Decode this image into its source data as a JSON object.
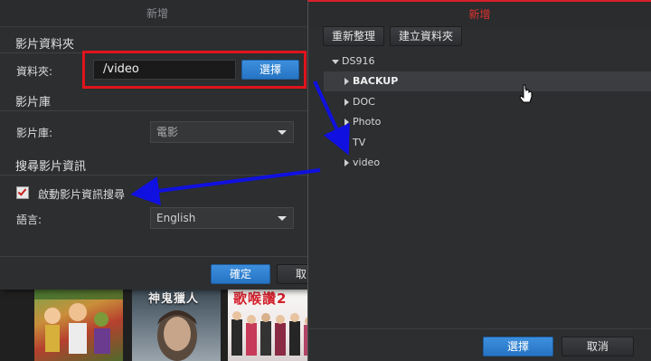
{
  "left_dialog": {
    "title": "新增",
    "section_folder": "影片資料夾",
    "folder_label": "資料夾:",
    "folder_value": "/video",
    "choose_button": "選擇",
    "section_library": "影片庫",
    "library_label": "影片庫:",
    "library_value": "電影",
    "section_search": "搜尋影片資訊",
    "enable_search_label": "啟動影片資訊搜尋",
    "language_label": "語言:",
    "language_value": "English",
    "ok_button": "確定",
    "cancel_button": "取"
  },
  "right_dialog": {
    "title": "新增",
    "refresh_button": "重新整理",
    "new_folder_button": "建立資料夾",
    "tree_root": "DS916",
    "tree_items": [
      "BACKUP",
      "DOC",
      "Photo",
      "TV",
      "video"
    ],
    "choose_button": "選擇",
    "cancel_button": "取消"
  },
  "posters": [
    {
      "title": ""
    },
    {
      "title": "神鬼獵人"
    },
    {
      "title": "歌喉讚2"
    }
  ],
  "colors": {
    "accent_blue": "#2f80d1",
    "annotation_red": "#e0141c",
    "arrow_blue": "#1010e0",
    "title_red": "#e1312f"
  },
  "icons": [
    "pointer-cursor-icon",
    "checkbox-checked-icon",
    "chevron-down-icon",
    "tree-expand-icon"
  ]
}
